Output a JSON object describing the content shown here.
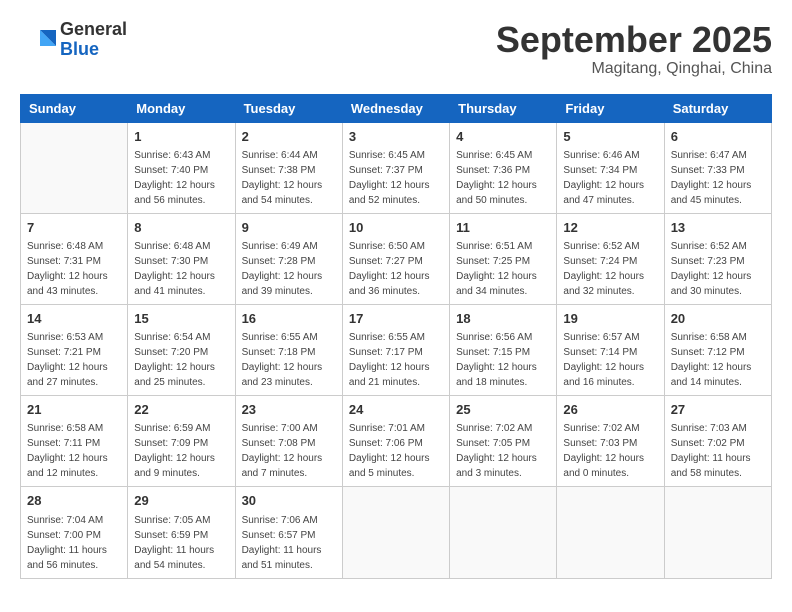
{
  "header": {
    "logo": {
      "general": "General",
      "blue": "Blue"
    },
    "title": "September 2025",
    "subtitle": "Magitang, Qinghai, China"
  },
  "weekdays": [
    "Sunday",
    "Monday",
    "Tuesday",
    "Wednesday",
    "Thursday",
    "Friday",
    "Saturday"
  ],
  "weeks": [
    [
      {
        "day": null
      },
      {
        "day": "1",
        "sunrise": "6:43 AM",
        "sunset": "7:40 PM",
        "daylight": "12 hours and 56 minutes."
      },
      {
        "day": "2",
        "sunrise": "6:44 AM",
        "sunset": "7:38 PM",
        "daylight": "12 hours and 54 minutes."
      },
      {
        "day": "3",
        "sunrise": "6:45 AM",
        "sunset": "7:37 PM",
        "daylight": "12 hours and 52 minutes."
      },
      {
        "day": "4",
        "sunrise": "6:45 AM",
        "sunset": "7:36 PM",
        "daylight": "12 hours and 50 minutes."
      },
      {
        "day": "5",
        "sunrise": "6:46 AM",
        "sunset": "7:34 PM",
        "daylight": "12 hours and 47 minutes."
      },
      {
        "day": "6",
        "sunrise": "6:47 AM",
        "sunset": "7:33 PM",
        "daylight": "12 hours and 45 minutes."
      }
    ],
    [
      {
        "day": "7",
        "sunrise": "6:48 AM",
        "sunset": "7:31 PM",
        "daylight": "12 hours and 43 minutes."
      },
      {
        "day": "8",
        "sunrise": "6:48 AM",
        "sunset": "7:30 PM",
        "daylight": "12 hours and 41 minutes."
      },
      {
        "day": "9",
        "sunrise": "6:49 AM",
        "sunset": "7:28 PM",
        "daylight": "12 hours and 39 minutes."
      },
      {
        "day": "10",
        "sunrise": "6:50 AM",
        "sunset": "7:27 PM",
        "daylight": "12 hours and 36 minutes."
      },
      {
        "day": "11",
        "sunrise": "6:51 AM",
        "sunset": "7:25 PM",
        "daylight": "12 hours and 34 minutes."
      },
      {
        "day": "12",
        "sunrise": "6:52 AM",
        "sunset": "7:24 PM",
        "daylight": "12 hours and 32 minutes."
      },
      {
        "day": "13",
        "sunrise": "6:52 AM",
        "sunset": "7:23 PM",
        "daylight": "12 hours and 30 minutes."
      }
    ],
    [
      {
        "day": "14",
        "sunrise": "6:53 AM",
        "sunset": "7:21 PM",
        "daylight": "12 hours and 27 minutes."
      },
      {
        "day": "15",
        "sunrise": "6:54 AM",
        "sunset": "7:20 PM",
        "daylight": "12 hours and 25 minutes."
      },
      {
        "day": "16",
        "sunrise": "6:55 AM",
        "sunset": "7:18 PM",
        "daylight": "12 hours and 23 minutes."
      },
      {
        "day": "17",
        "sunrise": "6:55 AM",
        "sunset": "7:17 PM",
        "daylight": "12 hours and 21 minutes."
      },
      {
        "day": "18",
        "sunrise": "6:56 AM",
        "sunset": "7:15 PM",
        "daylight": "12 hours and 18 minutes."
      },
      {
        "day": "19",
        "sunrise": "6:57 AM",
        "sunset": "7:14 PM",
        "daylight": "12 hours and 16 minutes."
      },
      {
        "day": "20",
        "sunrise": "6:58 AM",
        "sunset": "7:12 PM",
        "daylight": "12 hours and 14 minutes."
      }
    ],
    [
      {
        "day": "21",
        "sunrise": "6:58 AM",
        "sunset": "7:11 PM",
        "daylight": "12 hours and 12 minutes."
      },
      {
        "day": "22",
        "sunrise": "6:59 AM",
        "sunset": "7:09 PM",
        "daylight": "12 hours and 9 minutes."
      },
      {
        "day": "23",
        "sunrise": "7:00 AM",
        "sunset": "7:08 PM",
        "daylight": "12 hours and 7 minutes."
      },
      {
        "day": "24",
        "sunrise": "7:01 AM",
        "sunset": "7:06 PM",
        "daylight": "12 hours and 5 minutes."
      },
      {
        "day": "25",
        "sunrise": "7:02 AM",
        "sunset": "7:05 PM",
        "daylight": "12 hours and 3 minutes."
      },
      {
        "day": "26",
        "sunrise": "7:02 AM",
        "sunset": "7:03 PM",
        "daylight": "12 hours and 0 minutes."
      },
      {
        "day": "27",
        "sunrise": "7:03 AM",
        "sunset": "7:02 PM",
        "daylight": "11 hours and 58 minutes."
      }
    ],
    [
      {
        "day": "28",
        "sunrise": "7:04 AM",
        "sunset": "7:00 PM",
        "daylight": "11 hours and 56 minutes."
      },
      {
        "day": "29",
        "sunrise": "7:05 AM",
        "sunset": "6:59 PM",
        "daylight": "11 hours and 54 minutes."
      },
      {
        "day": "30",
        "sunrise": "7:06 AM",
        "sunset": "6:57 PM",
        "daylight": "11 hours and 51 minutes."
      },
      {
        "day": null
      },
      {
        "day": null
      },
      {
        "day": null
      },
      {
        "day": null
      }
    ]
  ]
}
